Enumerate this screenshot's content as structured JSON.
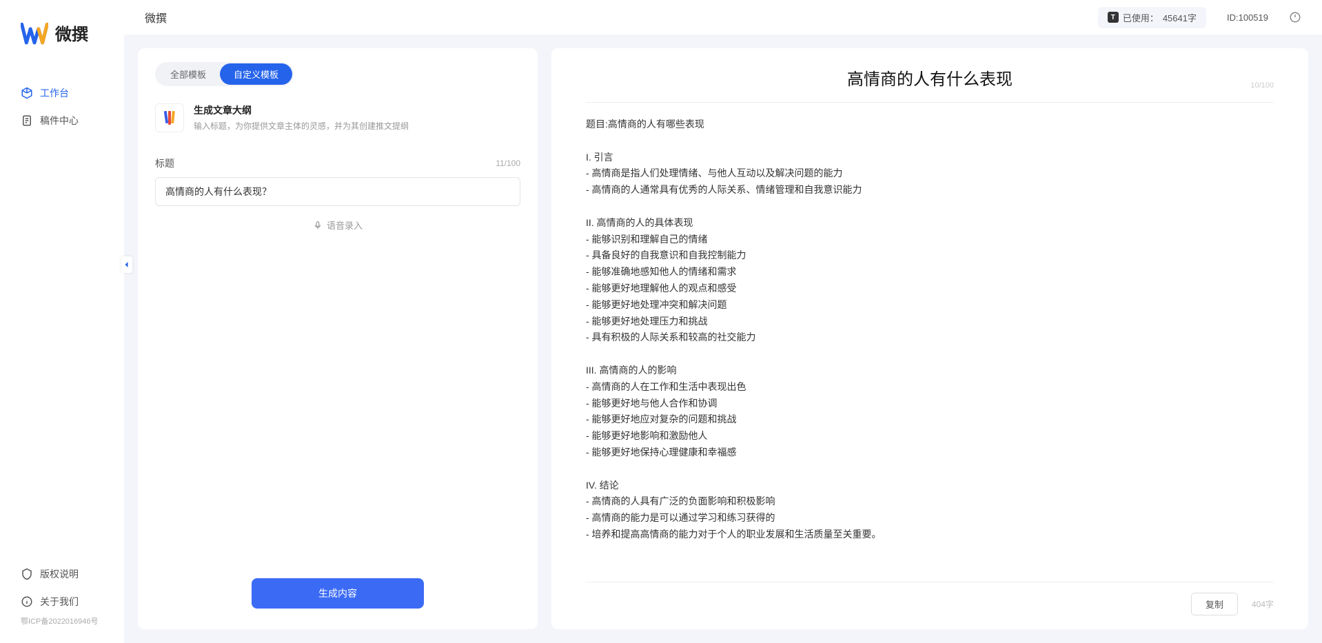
{
  "app": {
    "name": "微撰",
    "logo_alt": "W logo"
  },
  "sidebar": {
    "items": [
      {
        "label": "工作台",
        "icon": "cube",
        "active": true
      },
      {
        "label": "稿件中心",
        "icon": "doc",
        "active": false
      }
    ],
    "bottom_items": [
      {
        "label": "版权说明",
        "icon": "shield"
      },
      {
        "label": "关于我们",
        "icon": "info"
      }
    ],
    "icp": "鄂ICP备2022016946号"
  },
  "topbar": {
    "breadcrumb": "微撰",
    "usage_label": "已使用：",
    "usage_value": "45641字",
    "id_label": "ID:",
    "id_value": "100519"
  },
  "left_panel": {
    "tabs": [
      {
        "label": "全部模板",
        "active": false
      },
      {
        "label": "自定义模板",
        "active": true
      }
    ],
    "template": {
      "title": "生成文章大纲",
      "desc": "输入标题，为你提供文章主体的灵感，并为其创建推文提纲"
    },
    "form": {
      "title_label": "标题",
      "title_counter": "11/100",
      "title_value": "高情商的人有什么表现？",
      "voice_label": "语音录入"
    },
    "generate_btn": "生成内容"
  },
  "right_panel": {
    "title": "高情商的人有什么表现",
    "counter": "10/100",
    "body": "题目:高情商的人有哪些表现\n\nI. 引言\n- 高情商是指人们处理情绪、与他人互动以及解决问题的能力\n- 高情商的人通常具有优秀的人际关系、情绪管理和自我意识能力\n\nII. 高情商的人的具体表现\n- 能够识别和理解自己的情绪\n- 具备良好的自我意识和自我控制能力\n- 能够准确地感知他人的情绪和需求\n- 能够更好地理解他人的观点和感受\n- 能够更好地处理冲突和解决问题\n- 能够更好地处理压力和挑战\n- 具有积极的人际关系和较高的社交能力\n\nIII. 高情商的人的影响\n- 高情商的人在工作和生活中表现出色\n- 能够更好地与他人合作和协调\n- 能够更好地应对复杂的问题和挑战\n- 能够更好地影响和激励他人\n- 能够更好地保持心理健康和幸福感\n\nIV. 结论\n- 高情商的人具有广泛的负面影响和积极影响\n- 高情商的能力是可以通过学习和练习获得的\n- 培养和提高高情商的能力对于个人的职业发展和生活质量至关重要。",
    "copy_btn": "复制",
    "word_count": "404字"
  }
}
